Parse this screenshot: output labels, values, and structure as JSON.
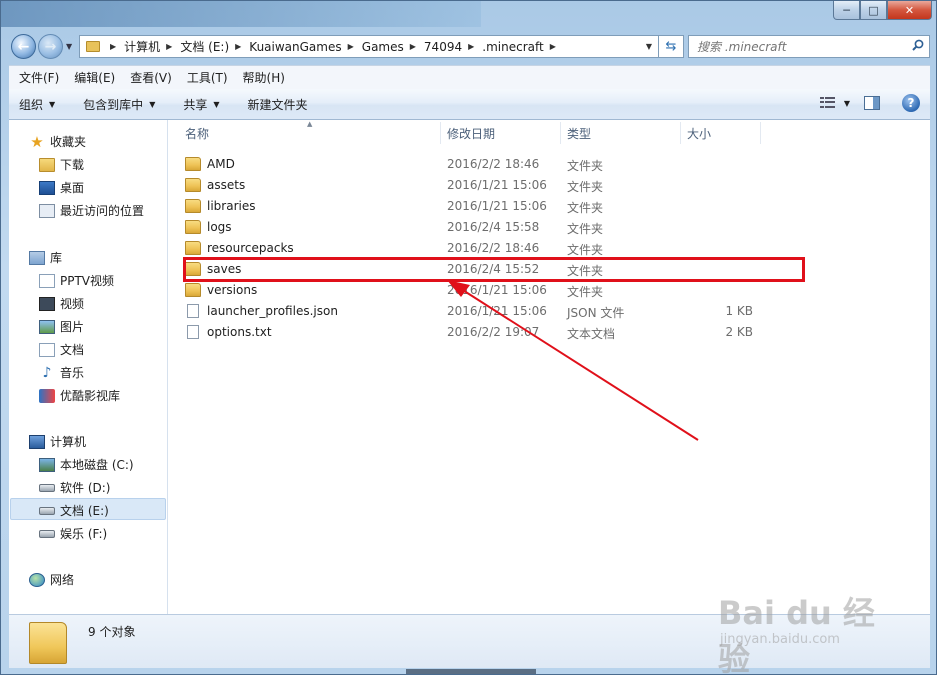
{
  "window": {
    "controls": {
      "minimize": "─",
      "maximize": "□",
      "close": "✕"
    }
  },
  "nav": {
    "back_icon": "back-arrow-icon",
    "forward_icon": "forward-arrow-icon",
    "breadcrumbs": [
      "计算机",
      "文档 (E:)",
      "KuaiwanGames",
      "Games",
      "74094",
      ".minecraft"
    ],
    "search_placeholder": "搜索 .minecraft"
  },
  "menu": [
    "文件(F)",
    "编辑(E)",
    "查看(V)",
    "工具(T)",
    "帮助(H)"
  ],
  "commands": [
    "组织",
    "包含到库中",
    "共享",
    "新建文件夹"
  ],
  "sidebar": {
    "favorites": {
      "label": "收藏夹",
      "items": [
        "下载",
        "桌面",
        "最近访问的位置"
      ]
    },
    "libraries": {
      "label": "库",
      "items": [
        "PPTV视频",
        "视频",
        "图片",
        "文档",
        "音乐",
        "优酷影视库"
      ]
    },
    "computer": {
      "label": "计算机",
      "items": [
        "本地磁盘 (C:)",
        "软件 (D:)",
        "文档 (E:)",
        "娱乐 (F:)"
      ],
      "selected": "文档 (E:)"
    },
    "network": {
      "label": "网络"
    }
  },
  "columns": {
    "name": "名称",
    "date": "修改日期",
    "type": "类型",
    "size": "大小"
  },
  "files": [
    {
      "name": "AMD",
      "date": "2016/2/2 18:46",
      "type": "文件夹",
      "size": "",
      "kind": "folder"
    },
    {
      "name": "assets",
      "date": "2016/1/21 15:06",
      "type": "文件夹",
      "size": "",
      "kind": "folder"
    },
    {
      "name": "libraries",
      "date": "2016/1/21 15:06",
      "type": "文件夹",
      "size": "",
      "kind": "folder"
    },
    {
      "name": "logs",
      "date": "2016/2/4 15:58",
      "type": "文件夹",
      "size": "",
      "kind": "folder"
    },
    {
      "name": "resourcepacks",
      "date": "2016/2/2 18:46",
      "type": "文件夹",
      "size": "",
      "kind": "folder"
    },
    {
      "name": "saves",
      "date": "2016/2/4 15:52",
      "type": "文件夹",
      "size": "",
      "kind": "folder"
    },
    {
      "name": "versions",
      "date": "2016/1/21 15:06",
      "type": "文件夹",
      "size": "",
      "kind": "folder"
    },
    {
      "name": "launcher_profiles.json",
      "date": "2016/1/21 15:06",
      "type": "JSON 文件",
      "size": "1 KB",
      "kind": "file"
    },
    {
      "name": "options.txt",
      "date": "2016/2/2 19:07",
      "type": "文本文档",
      "size": "2 KB",
      "kind": "file"
    }
  ],
  "annotation": {
    "highlight_color": "#e0101a",
    "highlighted_file": "saves"
  },
  "details": {
    "count": "9 个对象"
  },
  "watermark": {
    "brand": "Bai du 经验",
    "site": "jingyan.baidu.com"
  }
}
